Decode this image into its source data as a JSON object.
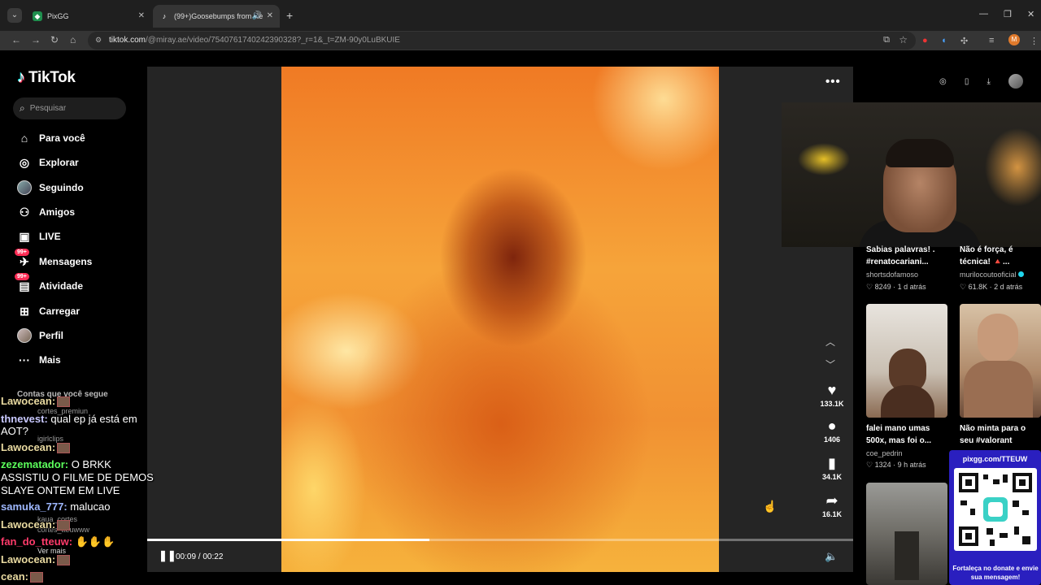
{
  "browser": {
    "tabs": [
      {
        "title": "PixGG",
        "icon": "pixgg-favicon"
      },
      {
        "title": "(99+)Goosebumps from Re",
        "icon": "tiktok-favicon"
      }
    ],
    "url_host": "tiktok.com",
    "url_path": "/@miray.ae/video/7540761740242390328?_r=1&_t=ZM-90y0LuBKUIE",
    "profile_initial": "M"
  },
  "sidebar": {
    "logo": "TikTok",
    "search_placeholder": "Pesquisar",
    "items": [
      {
        "label": "Para você",
        "icon": "home-icon"
      },
      {
        "label": "Explorar",
        "icon": "compass-icon"
      },
      {
        "label": "Seguindo",
        "icon": "following-avatar-icon"
      },
      {
        "label": "Amigos",
        "icon": "friends-icon"
      },
      {
        "label": "LIVE",
        "icon": "live-icon"
      },
      {
        "label": "Mensagens",
        "icon": "messages-icon",
        "badge": "99+"
      },
      {
        "label": "Atividade",
        "icon": "activity-icon",
        "badge": "99+"
      },
      {
        "label": "Carregar",
        "icon": "upload-icon"
      },
      {
        "label": "Perfil",
        "icon": "profile-avatar-icon"
      },
      {
        "label": "Mais",
        "icon": "more-icon"
      }
    ],
    "following_header": "Contas que você segue",
    "following_accounts": [
      "cortes_premiun",
      "igirlclips",
      "kaua_cortes",
      "cortes_tteuwww"
    ]
  },
  "chat": [
    {
      "user": "Lawocean:",
      "text": "",
      "color": "#e8d9a0"
    },
    {
      "user": "thnevest:",
      "text": "qual ep já está em",
      "color": "#c9c9ff"
    },
    {
      "user": "",
      "text": "AOT?",
      "color": ""
    },
    {
      "user": "Lawocean:",
      "text": "",
      "color": "#e8d9a0"
    },
    {
      "user": "zezematador:",
      "text": "O BRKK",
      "color": "#5cff5c"
    },
    {
      "user": "",
      "text": "ASSISTIU O FILME DE DEMOS",
      "color": ""
    },
    {
      "user": "",
      "text": "SLAYE ONTEM EM LIVE",
      "color": ""
    },
    {
      "user": "samuka_777:",
      "text": "malucao",
      "color": "#9fb8ff"
    },
    {
      "user": "Lawocean:",
      "text": "",
      "color": "#e8d9a0"
    },
    {
      "user": "fan_do_tteuw:",
      "text": "",
      "color": "#ff3b6b"
    },
    {
      "user": "Lawocean:",
      "text": "",
      "color": "#e8d9a0"
    },
    {
      "user": "cean:",
      "text": "",
      "color": "#e8d9a0"
    }
  ],
  "video": {
    "progress": 0.4,
    "time": "00:09 / 00:22",
    "likes": "133.1K",
    "comments": "1406",
    "saves": "34.1K",
    "shares": "16.1K"
  },
  "feed": [
    {
      "caption": "Sabias palavras! . #renatocariani...",
      "author": "shortsdofamoso",
      "likes": "8249",
      "age": "1 d atrás"
    },
    {
      "caption": "Não é força, é técnica! 🔺...",
      "author": "murilocoutooficial",
      "likes": "61.8K",
      "age": "2 d atrás",
      "verified": true
    },
    {
      "caption": "falei mano umas 500x, mas foi o...",
      "author": "coe_pedrin",
      "likes": "1324",
      "age": "9 h atrás"
    },
    {
      "caption": "Não minta para o seu #valorant",
      "author": "",
      "likes": "",
      "age": ""
    }
  ],
  "overlay": {
    "qr_url": "pixgg.com/TTEUW",
    "qr_caption": "Fortaleça no donate e envie sua mensagem!"
  }
}
